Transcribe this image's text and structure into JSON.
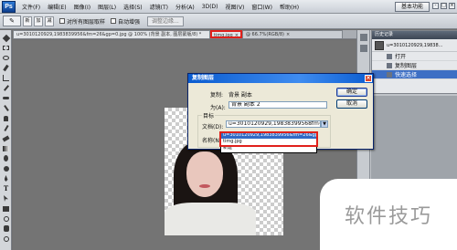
{
  "app": {
    "logo": "Ps"
  },
  "menubar": {
    "items": [
      "文件(F)",
      "编辑(E)",
      "图像(I)",
      "图层(L)",
      "选择(S)",
      "滤镜(T)",
      "分析(A)",
      "3D(D)",
      "视图(V)",
      "窗口(W)",
      "帮助(H)"
    ],
    "workspace": "基本功能",
    "window_controls": [
      "-",
      "□",
      "×"
    ]
  },
  "options_bar": {
    "tool_preset_icon": "quick-selection-tool-icon",
    "modes": [
      "新",
      "加",
      "减"
    ],
    "sample_all_layers": "对所有图层取样",
    "auto_enhance": "自动增强",
    "refine_edge": "调整边缘..."
  },
  "tabs": [
    {
      "label": "u=3010120929,1983839956&fm=26&gp=0.jpg @ 100% (背景 副本, 图层蒙版/8) *",
      "close": "×"
    },
    {
      "label": "timg.jpg",
      "close": "×"
    },
    {
      "label": "@ 66.7%(RGB/8)",
      "close": "×"
    }
  ],
  "history_panel": {
    "title": "历史记录",
    "snapshot": "u=3010120929,19838...",
    "items": [
      "打开",
      "复制图层",
      "快速选择"
    ]
  },
  "dialog": {
    "title": "复制图层",
    "copy_label": "复制:",
    "copy_value": "背景 副本",
    "as_label": "为(A):",
    "as_value": "背景 副本 2",
    "group_label": "目标",
    "doc_label": "文档(D):",
    "doc_value": "u=3010120929,19838399568fm=26...",
    "name_label": "名称(N):",
    "ok_label": "确定",
    "cancel_label": "取消",
    "options": [
      "u=3010120929,1983839956&fm=26&gp=0.jpg",
      "timg.jpg",
      "新建"
    ],
    "selected_option": "u=3010120929,1983839956&fm=26&gp=0.jpg"
  },
  "watermark": "软件技巧",
  "colors": {
    "highlight": "#e0201b",
    "selection": "#316ac5"
  }
}
